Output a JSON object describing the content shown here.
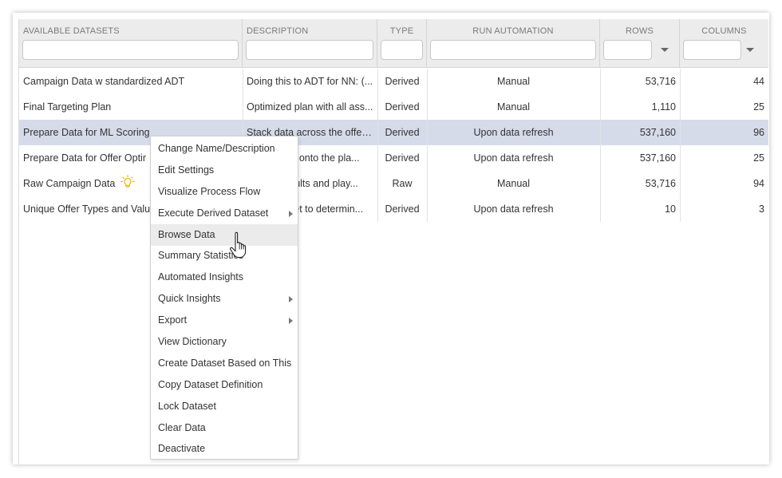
{
  "columns": [
    {
      "label": "AVAILABLE DATASETS"
    },
    {
      "label": "DESCRIPTION"
    },
    {
      "label": "TYPE"
    },
    {
      "label": "RUN AUTOMATION"
    },
    {
      "label": "ROWS"
    },
    {
      "label": "COLUMNS"
    }
  ],
  "filters": [
    "",
    "",
    "",
    "",
    "",
    ""
  ],
  "rows": [
    {
      "name": "Campaign Data w standardized ADT",
      "description": "Doing this to ADT for NN: (...",
      "type": "Derived",
      "automation": "Manual",
      "rows": "53,716",
      "columns": "44"
    },
    {
      "name": "Final Targeting Plan",
      "description": "Optimized plan with all ass...",
      "type": "Derived",
      "automation": "Manual",
      "rows": "1,110",
      "columns": "25"
    },
    {
      "name": "Prepare Data for ML Scoring",
      "description": "Stack data across the offer ...",
      "type": "Derived",
      "automation": "Upon data refresh",
      "rows": "537,160",
      "columns": "96",
      "selected": true
    },
    {
      "name": "Prepare Data for Offer Optir",
      "description": "res onto the pla...",
      "type": "Derived",
      "automation": "Upon data refresh",
      "rows": "537,160",
      "columns": "25"
    },
    {
      "name": "Raw Campaign Data",
      "description": "esults and play...",
      "type": "Raw",
      "automation": "Manual",
      "rows": "53,716",
      "columns": "94",
      "icon": "lightbulb-icon"
    },
    {
      "name": "Unique Offer Types and Valu",
      "description": "set to determin...",
      "type": "Derived",
      "automation": "Upon data refresh",
      "rows": "10",
      "columns": "3"
    }
  ],
  "context_menu": [
    {
      "label": "Change Name/Description"
    },
    {
      "label": "Edit Settings"
    },
    {
      "label": "Visualize Process Flow"
    },
    {
      "label": "Execute Derived Dataset",
      "submenu": true
    },
    {
      "label": "Browse Data",
      "hover": true
    },
    {
      "label": "Summary Statistics"
    },
    {
      "label": "Automated Insights"
    },
    {
      "label": "Quick Insights",
      "submenu": true
    },
    {
      "label": "Export",
      "submenu": true
    },
    {
      "label": "View Dictionary"
    },
    {
      "label": "Create Dataset Based on This"
    },
    {
      "label": "Copy Dataset Definition"
    },
    {
      "label": "Lock Dataset"
    },
    {
      "label": "Clear Data"
    },
    {
      "label": "Deactivate"
    }
  ],
  "colors": {
    "selected_row": "#d5dbe9",
    "header_bg": "#ececec",
    "bulb": "#f0b400"
  },
  "icons": [
    "lightbulb-icon",
    "dropdown-arrow-icon",
    "submenu-arrow-icon",
    "hand-cursor-icon"
  ]
}
